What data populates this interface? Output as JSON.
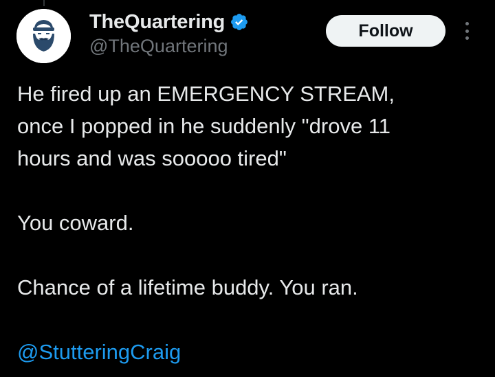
{
  "author": {
    "display_name": "TheQuartering",
    "handle": "@TheQuartering",
    "verified": true,
    "avatar": "bearded-man-logo",
    "follow_label": "Follow",
    "more_icon": "more-vertical-icon"
  },
  "tweet": {
    "line1": "He fired up an EMERGENCY STREAM,",
    "line2": "once I popped in he suddenly \"drove 11",
    "line3": "hours and was sooooo tired\"",
    "line4": "You coward.",
    "line5": "Chance of a lifetime buddy.  You ran.",
    "mention": "@StutteringCraig"
  },
  "colors": {
    "background": "#000000",
    "text": "#e7e9ea",
    "secondary_text": "#71767b",
    "accent": "#1d9bf0",
    "button_bg": "#eff3f4",
    "button_text": "#0f1419"
  }
}
